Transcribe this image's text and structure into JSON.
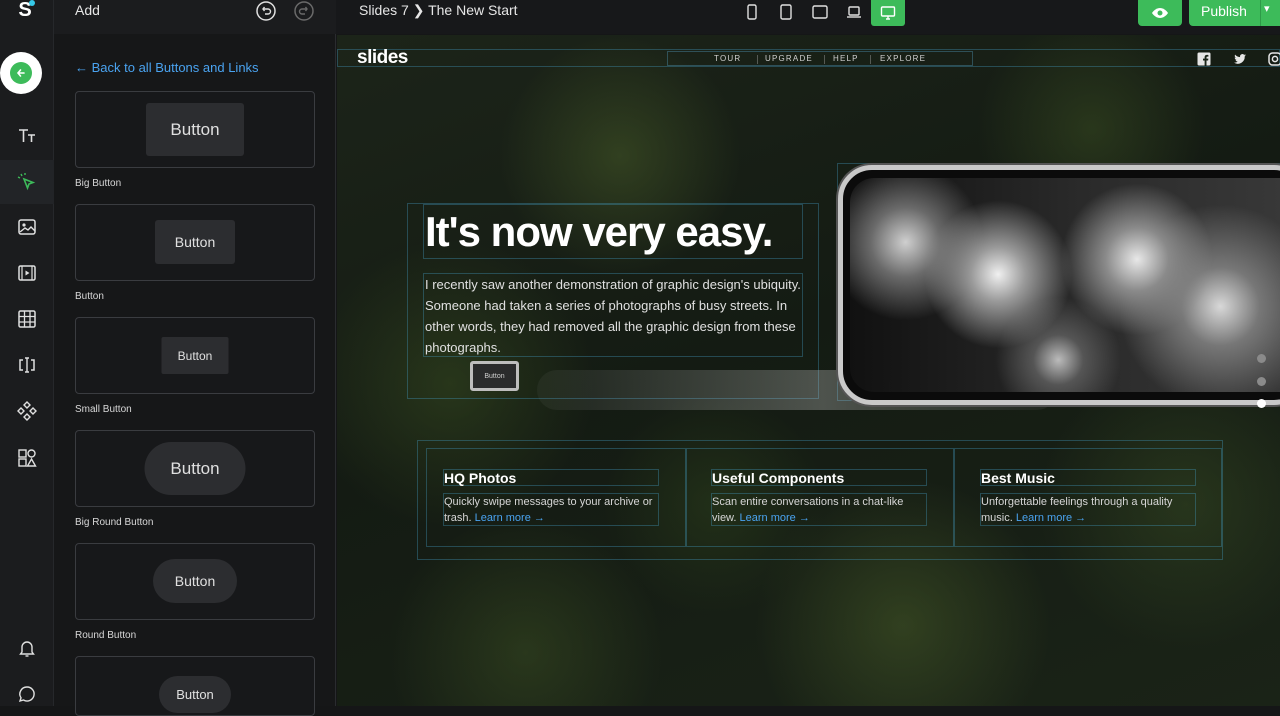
{
  "app": {
    "logo_letter": "S",
    "panel_title": "Add",
    "breadcrumb": "Slides 7  ❯  The New Start",
    "publish_label": "Publish",
    "accent_color": "#3dbb5a",
    "link_color": "#4aa3f0"
  },
  "rail": {
    "items": [
      {
        "icon": "arrow-left-icon"
      },
      {
        "icon": "text-icon"
      },
      {
        "icon": "cursor-click-icon"
      },
      {
        "icon": "image-icon"
      },
      {
        "icon": "video-icon"
      },
      {
        "icon": "grid-icon"
      },
      {
        "icon": "form-input-icon"
      },
      {
        "icon": "components-icon"
      },
      {
        "icon": "shapes-icon"
      },
      {
        "icon": "bell-icon"
      },
      {
        "icon": "chat-icon"
      }
    ]
  },
  "panel": {
    "back_link": "← Back to all Buttons and Links",
    "cards": [
      {
        "button_text": "Button",
        "label": "Big Button"
      },
      {
        "button_text": "Button",
        "label": "Button"
      },
      {
        "button_text": "Button",
        "label": "Small Button"
      },
      {
        "button_text": "Button",
        "label": "Big Round Button"
      },
      {
        "button_text": "Button",
        "label": "Round Button"
      },
      {
        "button_text": "Button",
        "label": ""
      }
    ]
  },
  "devices": [
    "phone-portrait-icon",
    "tablet-portrait-icon",
    "tablet-landscape-icon",
    "laptop-icon",
    "desktop-icon"
  ],
  "site": {
    "logo": "slides",
    "nav": [
      "TOUR",
      "UPGRADE",
      "HELP",
      "EXPLORE"
    ],
    "social": [
      "facebook-icon",
      "twitter-icon",
      "instagram-icon"
    ],
    "hero_title": "It's now very easy.",
    "hero_body": "I recently saw another demonstration of graphic design's ubiquity. Someone had taken a series of photographs of busy streets. In other words, they had removed all the graphic design from these photographs.",
    "hero_button": "Button",
    "features": [
      {
        "title": "HQ Photos",
        "text": "Quickly swipe messages to your archive or trash.",
        "link": "Learn more →"
      },
      {
        "title": "Useful Components",
        "text": "Scan entire conversations in a chat-like view.",
        "link": "Learn more →"
      },
      {
        "title": "Best Music",
        "text": "Unforgettable feelings through a quality music.",
        "link": "Learn more →"
      }
    ]
  }
}
